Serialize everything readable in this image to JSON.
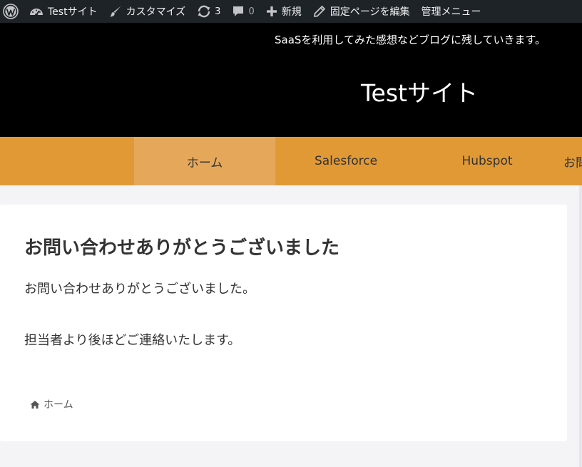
{
  "adminbar": {
    "site_name": "Testサイト",
    "customize": "カスタマイズ",
    "updates_count": "3",
    "comments_count": "0",
    "new_label": "新規",
    "edit_page": "固定ページを編集",
    "admin_menu": "管理メニュー"
  },
  "header": {
    "tagline": "SaaSを利用してみた感想などブログに残していきます。",
    "site_title": "Testサイト"
  },
  "nav": {
    "items": [
      {
        "label": "ホーム"
      },
      {
        "label": "Salesforce"
      },
      {
        "label": "Hubspot"
      },
      {
        "label": "お問"
      }
    ]
  },
  "content": {
    "title": "お問い合わせありがとうございました",
    "paragraph1": "お問い合わせありがとうございました。",
    "paragraph2": "担当者より後ほどご連絡いたします。",
    "breadcrumb_home": "ホーム"
  },
  "colors": {
    "adminbar_bg": "#1d2327",
    "header_bg": "#000000",
    "nav_bg": "#e09935",
    "nav_active_bg": "#e5a85b",
    "page_bg": "#f4f4f6"
  },
  "icons": {
    "wordpress": "wordpress-logo-icon",
    "dashboard": "dashboard-icon",
    "brush": "brush-icon",
    "updates": "refresh-icon",
    "comments": "comment-icon",
    "new": "plus-icon",
    "edit": "pencil-icon",
    "home": "home-icon"
  }
}
